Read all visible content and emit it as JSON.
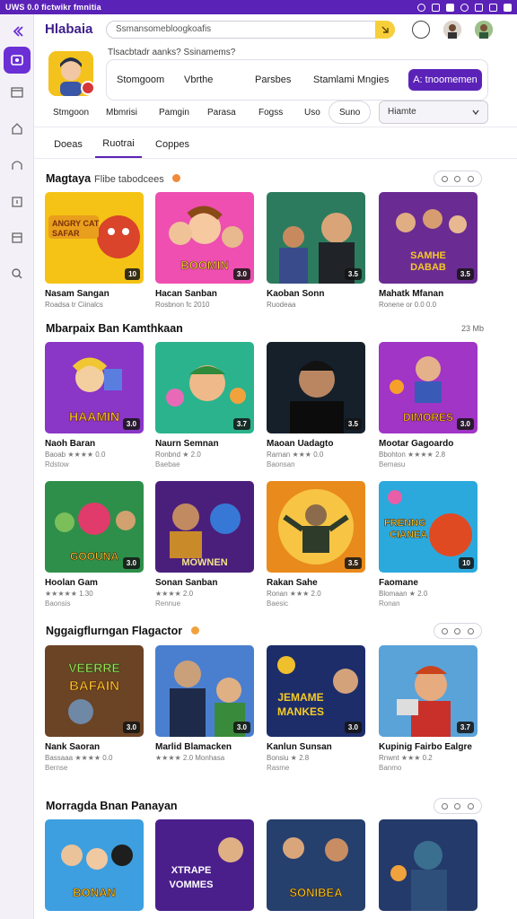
{
  "window": {
    "title": "UWS 0.0 fictwikr fmnitia"
  },
  "header": {
    "app_title": "Hlabaia",
    "search_value": "Ssmansomebloogkoafis",
    "hint": "Tlsacbtadr aanks? Ssinamems?"
  },
  "categories": [
    "Stomgoom",
    "Vbrthe",
    "Parsbes",
    "Stamlami Mngies"
  ],
  "primary_button": "A: tnoomemen",
  "filters": [
    "Stmgoon",
    "Mbmrisi",
    "Pamgin",
    "Parasa",
    "Fogss",
    "Uso",
    "Suno"
  ],
  "select": {
    "value": "Hiamte"
  },
  "tabs": [
    "Doeas",
    "Ruotrai",
    "Coppes"
  ],
  "sections": [
    {
      "title": "Magtaya",
      "subtitle": "Flibe tabodcees",
      "cards": [
        {
          "name": "Nasam Sangan",
          "meta": "Roadsa tr Ciinalcs",
          "tag": "10",
          "art": "ANGRY CAT SAFAR"
        },
        {
          "name": "Hacan Sanban",
          "meta": "Rosbnon fc 2010",
          "tag": "3.0",
          "art": "BOOMIN"
        },
        {
          "name": "Kaoban Sonn",
          "meta": "Ruodeaa",
          "tag": "3.5",
          "art": ""
        },
        {
          "name": "Mahatk Mfanan",
          "meta": "Ronene or 0.0 0.0",
          "tag": "3.5",
          "art": "SAMHE DABAB"
        }
      ]
    },
    {
      "title": "Mbarpaix Ban Kamthkaan",
      "subtitle": "",
      "right_meta": "23 Mb",
      "cards": [
        {
          "name": "Naoh Baran",
          "meta": "Baoab ★★★★ 0.0",
          "meta2": "Rdstow",
          "tag": "3.0",
          "art": "HAAMIN"
        },
        {
          "name": "Naurn Semnan",
          "meta": "Ronbnd ★ 2.0",
          "meta2": "Baebae",
          "tag": "3.7",
          "art": ""
        },
        {
          "name": "Maoan Uadagto",
          "meta": "Rarnan ★★★ 0.0",
          "meta2": "Baonsan",
          "tag": "3.5",
          "art": ""
        },
        {
          "name": "Mootar Gagoardo",
          "meta": "Bbohton ★★★★ 2.8",
          "meta2": "Bemasu",
          "tag": "3.0",
          "art": "DIMORES"
        }
      ]
    },
    {
      "title": "",
      "subtitle": "",
      "cards": [
        {
          "name": "Hoolan Gam",
          "meta": "★★★★★ 1.30",
          "meta2": "Baonsis",
          "tag": "3.0",
          "art": "GOOUNA"
        },
        {
          "name": "Sonan Sanban",
          "meta": "★★★★ 2.0",
          "meta2": "Rennue",
          "tag": "",
          "art": "MOWNEN"
        },
        {
          "name": "Rakan Sahe",
          "meta": "Ronan ★★★ 2.0",
          "meta2": "Baesic",
          "tag": "3.5",
          "art": ""
        },
        {
          "name": "Faomane",
          "meta": "Blomaan ★ 2.0",
          "meta2": "Ronan",
          "tag": "10",
          "art": "FRENNG CIANEA"
        }
      ]
    },
    {
      "title": "Nggaigflurngan Flagactor",
      "subtitle": "",
      "cards": [
        {
          "name": "Nank Saoran",
          "meta": "Bassaaa ★★★★ 0.0",
          "meta2": "Bernse",
          "tag": "3.0",
          "art": "VEERRE BAFAIN"
        },
        {
          "name": "Marlid Blamacken",
          "meta": "★★★★ 2.0 Monhasa",
          "meta2": "",
          "tag": "3.0",
          "art": ""
        },
        {
          "name": "Kanlun Sunsan",
          "meta": "Bonsiu ★ 2.8",
          "meta2": "Rasme",
          "tag": "3.0",
          "art": "JEMAME MANKES"
        },
        {
          "name": "Kupinig Fairbo Ealgre",
          "meta": "Rnwnt ★★★ 0.2",
          "meta2": "Banmo",
          "tag": "3.7",
          "art": ""
        }
      ]
    },
    {
      "title": "Morragda Bnan Panayan",
      "subtitle": "",
      "cards": [
        {
          "name": "",
          "meta": "",
          "meta2": "",
          "tag": "",
          "art": "BONAN"
        },
        {
          "name": "",
          "meta": "",
          "meta2": "",
          "tag": "",
          "art": "XTRAPE VOMMES"
        },
        {
          "name": "",
          "meta": "",
          "meta2": "",
          "tag": "",
          "art": "SONIBEA"
        },
        {
          "name": "",
          "meta": "",
          "meta2": "",
          "tag": "",
          "art": ""
        }
      ]
    }
  ],
  "colors": {
    "accent": "#5b22b8",
    "sidebar_bg": "#f3f1f7",
    "search_btn": "#f7cf3b"
  }
}
